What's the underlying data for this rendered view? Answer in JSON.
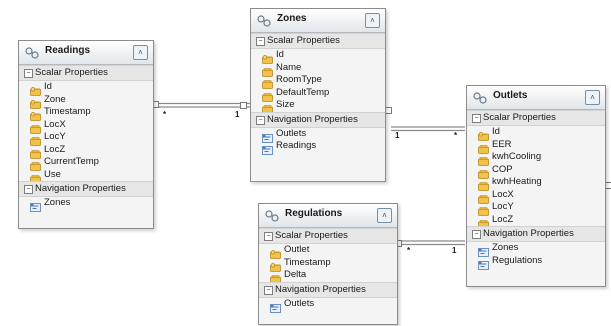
{
  "entities": {
    "readings": {
      "title": "Readings",
      "scalar_label": "Scalar Properties",
      "scalar": [
        "Id",
        "Zone",
        "Timestamp",
        "LocX",
        "LocY",
        "LocZ",
        "CurrentTemp",
        "Use"
      ],
      "nav_label": "Navigation Properties",
      "nav": [
        "Zones"
      ]
    },
    "zones": {
      "title": "Zones",
      "scalar_label": "Scalar Properties",
      "scalar": [
        "Id",
        "Name",
        "RoomType",
        "DefaultTemp",
        "Size"
      ],
      "nav_label": "Navigation Properties",
      "nav": [
        "Outlets",
        "Readings"
      ]
    },
    "outlets": {
      "title": "Outlets",
      "scalar_label": "Scalar Properties",
      "scalar": [
        "Id",
        "EER",
        "kwhCooling",
        "COP",
        "kwhHeating",
        "LocX",
        "LocY",
        "LocZ"
      ],
      "nav_label": "Navigation Properties",
      "nav": [
        "Zones",
        "Regulations"
      ]
    },
    "regulations": {
      "title": "Regulations",
      "scalar_label": "Scalar Properties",
      "scalar": [
        "Outlet",
        "Timestamp",
        "Delta"
      ],
      "nav_label": "Navigation Properties",
      "nav": [
        "Outlets"
      ]
    }
  },
  "associations": [
    {
      "from": "readings",
      "to": "zones",
      "from_mult": "*",
      "to_mult": "1"
    },
    {
      "from": "zones",
      "to": "outlets",
      "from_mult": "1",
      "to_mult": "*"
    },
    {
      "from": "regulations",
      "to": "outlets",
      "from_mult": "*",
      "to_mult": "1"
    }
  ],
  "colors": {
    "key_icon": "#d9a21b",
    "prop_icon": "#c98a10",
    "nav_icon": "#4a79b5",
    "link": "#8a8a8a"
  },
  "icons": {
    "entity": "entity-icon",
    "key": "key-property-icon",
    "property": "property-icon",
    "navigation": "navigation-property-icon",
    "collapse": "collapse-chevron-icon"
  }
}
